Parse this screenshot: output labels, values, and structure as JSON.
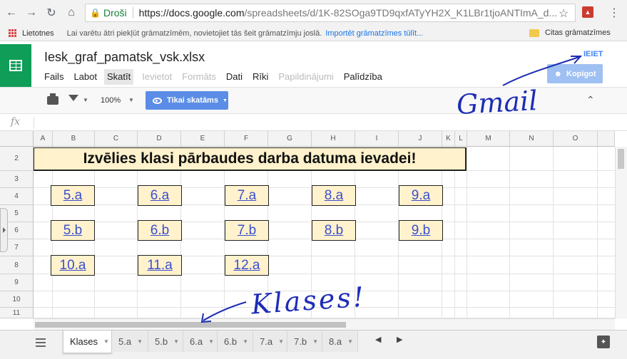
{
  "browser": {
    "secure_label": "Droši",
    "url_host": "https://docs.google.com",
    "url_path": "/spreadsheets/d/1K-82SOga9TD9qxfATyYH2X_K1LBr1tjoANTImA_d...",
    "bookmarks": {
      "apps": "Lietotnes",
      "hint": "Lai varētu ātri piekļūt grāmatzīmēm, novietojiet tās šeit grāmatzīmju joslā.",
      "import": "Importēt grāmatzīmes tūlīt...",
      "other": "Citas grāmatzīmes"
    }
  },
  "sheet": {
    "title": "Iesk_graf_pamatsk_vsk.xlsx",
    "signin": "IEIET",
    "copy_label": "Kopigot",
    "menu": [
      "Fails",
      "Labot",
      "Skatīt",
      "Ievietot",
      "Formāts",
      "Dati",
      "Rīki",
      "Papildinājumi",
      "Palīdzība"
    ],
    "menu_disabled": [
      false,
      false,
      false,
      true,
      true,
      false,
      false,
      true,
      false
    ],
    "active_menu_index": 2
  },
  "toolbar": {
    "zoom": "100%",
    "view_only": "Tikai skatāms"
  },
  "formula": {
    "fx": "fx"
  },
  "grid": {
    "columns": [
      "A",
      "B",
      "C",
      "D",
      "E",
      "F",
      "G",
      "H",
      "I",
      "J",
      "K",
      "L",
      "M",
      "N",
      "O"
    ],
    "rows": [
      "2",
      "3",
      "4",
      "5",
      "6",
      "7",
      "8",
      "9",
      "10",
      "11"
    ],
    "banner": "Izvēlies klasi pārbaudes darba datuma ievadei!",
    "classes": [
      [
        "5.a",
        "6.a",
        "7.a",
        "8.a",
        "9.a"
      ],
      [
        "5.b",
        "6.b",
        "7.b",
        "8.b",
        "9.b"
      ],
      [
        "10.a",
        "11.a",
        "12.a"
      ]
    ]
  },
  "tabs": [
    "Klases",
    "5.a",
    "5.b",
    "6.a",
    "6.b",
    "7.a",
    "7.b",
    "8.a"
  ],
  "annotations": {
    "gmail": "Gmail",
    "klases": "Klases!",
    "color": "#1d2db5"
  },
  "colors": {
    "sheets_green": "#0f9d58",
    "cell_fill": "#fff2cc",
    "link": "#3b4fd1",
    "view_button": "#5b8de6"
  }
}
